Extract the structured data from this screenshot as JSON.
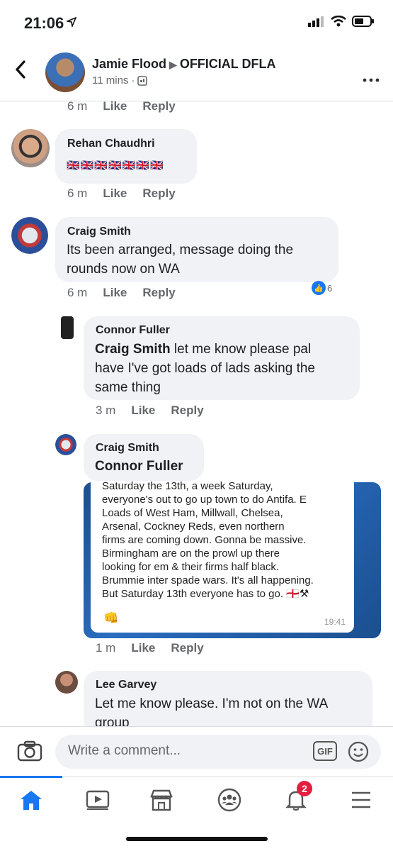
{
  "status_bar": {
    "time": "21:06"
  },
  "header": {
    "author": "Jamie Flood",
    "group": "OFFICIAL DFLA",
    "time": "11 mins",
    "dot": "·"
  },
  "comments": [
    {
      "id": "top",
      "time": "6 m",
      "like": "Like",
      "reply": "Reply"
    },
    {
      "id": "rehan",
      "name": "Rehan Chaudhri",
      "text": "🇬🇧🇬🇧🇬🇧🇬🇧🇬🇧🇬🇧🇬🇧",
      "time": "6 m",
      "like": "Like",
      "reply": "Reply"
    },
    {
      "id": "craig1",
      "name": "Craig Smith",
      "text_lines": [
        "Its been arranged, message doing the",
        "rounds now on WA"
      ],
      "time": "6 m",
      "like": "Like",
      "reply": "Reply",
      "reaction_count": "6"
    },
    {
      "id": "connor",
      "name": "Connor Fuller",
      "mention": "Craig Smith",
      "text_rest": " let me know please pal",
      "text_lines": [
        "have I've got loads of lads asking the",
        "same thing"
      ],
      "time": "3 m",
      "like": "Like",
      "reply": "Reply"
    },
    {
      "id": "craig2",
      "name": "Craig Smith",
      "mention": "Connor Fuller",
      "time": "1 m",
      "like": "Like",
      "reply": "Reply"
    },
    {
      "id": "lee",
      "name": "Lee Garvey",
      "text_lines": [
        "Let me know please. I'm not on the WA",
        "group"
      ]
    }
  ],
  "shared_image": {
    "lines": [
      "Saturday the 13th, a week Saturday,",
      "everyone's out to go up town to do Antifa. E",
      "Loads of West Ham, Millwall, Chelsea,",
      "Arsenal, Cockney Reds, even northern",
      "firms are coming down. Gonna be massive.",
      "Birmingham are on the prowl up there",
      "looking for em & their firms half black.",
      "Brummie inter spade wars. It's all happening.",
      "But Saturday 13th everyone has to go. 🏴󠁧󠁢󠁥󠁮󠁧󠁿⚒"
    ],
    "emoji": "👊",
    "time": "19:41"
  },
  "composer": {
    "placeholder": "Write a comment...",
    "gif": "GIF"
  },
  "tabbar": {
    "notification_count": "2"
  },
  "colors": {
    "accent": "#1877f2",
    "bubble": "#f0f2f5",
    "badge": "#e41e3f"
  }
}
